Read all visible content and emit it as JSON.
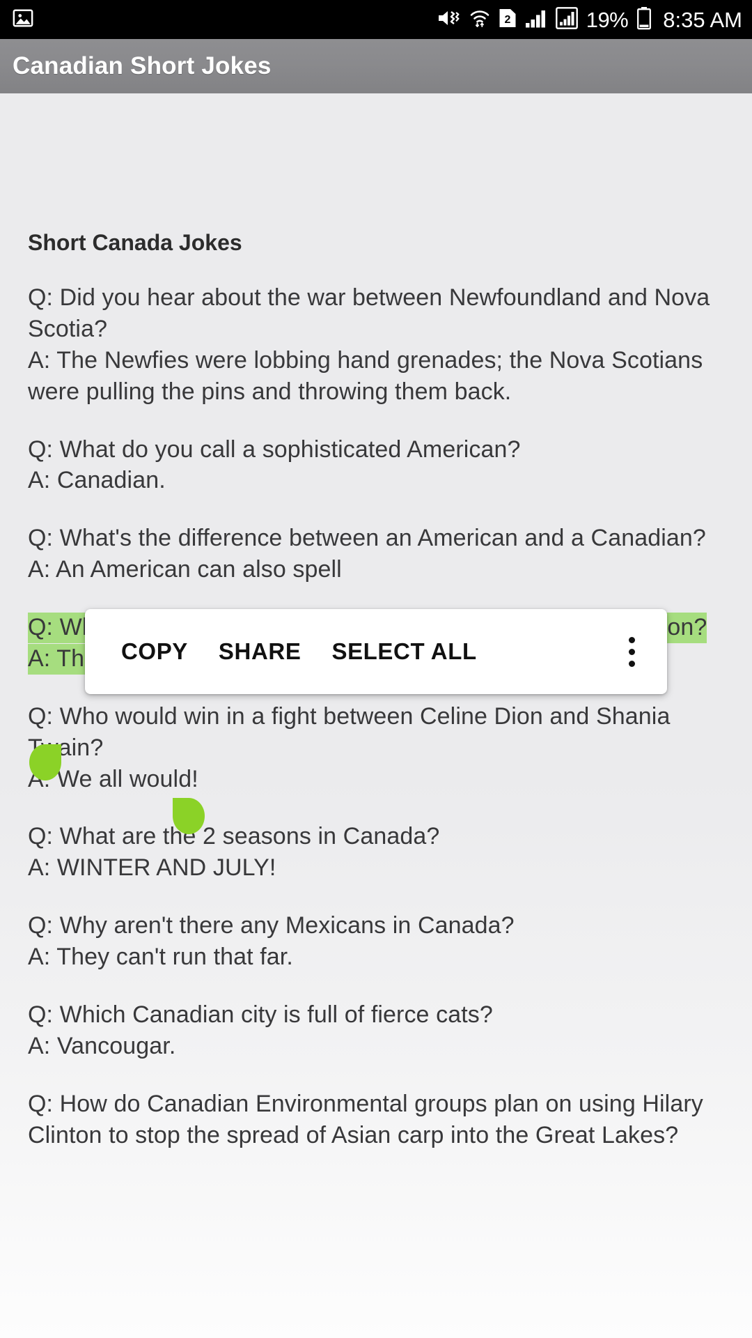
{
  "status_bar": {
    "left_icons": [
      {
        "name": "image-icon",
        "glyph": "picture"
      }
    ],
    "right_icons": [
      {
        "name": "mute-vibrate-icon",
        "glyph": "speaker-muted"
      },
      {
        "name": "wifi-icon",
        "glyph": "wifi-transfer"
      },
      {
        "name": "sim-2-icon",
        "glyph": "sim-card",
        "label": "2"
      },
      {
        "name": "signal-bars-icon",
        "glyph": "signal"
      },
      {
        "name": "signal-bars-boxed-icon",
        "glyph": "signal-boxed"
      }
    ],
    "battery_percent": "19%",
    "battery_icon": "battery-low-icon",
    "clock": "8:35 AM"
  },
  "action_bar": {
    "title": "Canadian Short Jokes"
  },
  "content": {
    "heading": "Short Canada Jokes",
    "jokes": [
      {
        "id": "joke-newfoundland-war",
        "text": "Q: Did you hear about the war between Newfoundland and Nova Scotia?\nA: The Newfies were lobbing hand grenades; the Nova Scotians were pulling the pins and throwing them back."
      },
      {
        "id": "joke-sophisticated-american",
        "text": "Q: What do you call a sophisticated American?\nA: Canadian."
      },
      {
        "id": "joke-american-vs-canadian",
        "text": "Q: What's the difference between an American and a Canadian?\nA: An American can also spell"
      },
      {
        "id": "joke-urine-samples",
        "text": "Q: What do urine samples and Canadian beer have in common?\nA: The taste!",
        "selected": true
      },
      {
        "id": "joke-celine-shania",
        "text": "Q: Who would win in a fight between Celine Dion and Shania Twain?\nA: We all would!"
      },
      {
        "id": "joke-two-seasons",
        "text": "Q: What are the 2 seasons in Canada?\nA: WINTER AND JULY!"
      },
      {
        "id": "joke-mexicans",
        "text": "Q: Why aren't there any Mexicans in Canada?\nA: They can't run that far."
      },
      {
        "id": "joke-fierce-cats",
        "text": "Q: Which Canadian city is full of fierce cats?\nA: Vancougar."
      },
      {
        "id": "joke-asian-carp",
        "text": "Q: How do Canadian Environmental groups plan on using Hilary Clinton to stop the spread of Asian carp into the Great Lakes?"
      }
    ]
  },
  "text_action_menu": {
    "copy_label": "COPY",
    "share_label": "SHARE",
    "select_all_label": "SELECT ALL",
    "overflow_name": "more-options-icon"
  },
  "colors": {
    "status_bar_bg": "#000000",
    "action_bar_bg": "#8a8a8d",
    "content_bg": "#ebebed",
    "selection_highlight": "#a6dd7f",
    "selection_handle": "#8bd227",
    "text": "#38383a",
    "menu_bg": "#ffffff"
  }
}
